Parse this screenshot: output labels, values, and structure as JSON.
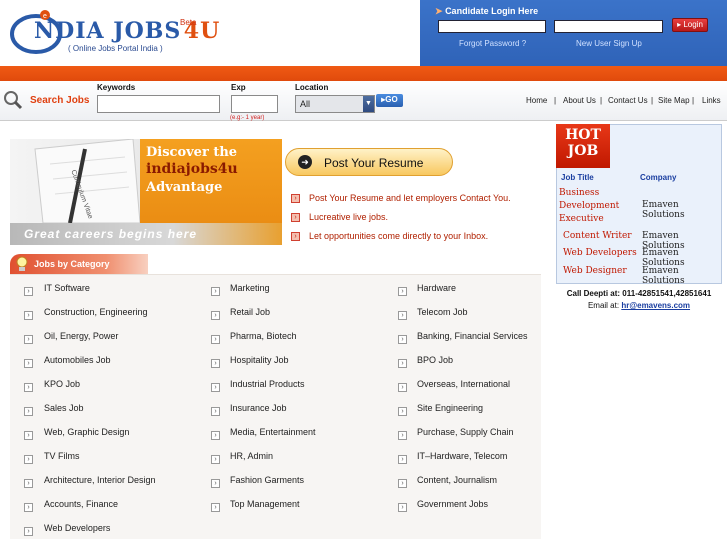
{
  "header": {
    "logo_main": "NDIA JOBS",
    "logo_4u": "4U",
    "logo_beta": "Beta",
    "logo_sub": "( Online Jobs Portal India )"
  },
  "login": {
    "title": "Candidate Login Here",
    "button": "Login",
    "forgot": "Forgot Password ?",
    "signup": "New User Sign Up"
  },
  "search": {
    "label": "Search Jobs",
    "keywords_label": "Keywords",
    "exp_label": "Exp",
    "exp_hint": "(e.g:- 1 year)",
    "location_label": "Location",
    "location_value": "All",
    "go": "GO"
  },
  "nav": [
    "Home",
    "About Us",
    "Contact Us",
    "Site Map",
    "Links"
  ],
  "banner": {
    "promo_line1": "Discover the",
    "promo_brand": "indiajobs4u",
    "promo_line3": "Advantage",
    "strip": "Great careers begins here",
    "cv_label": "Curriculum Vitae",
    "post_resume": "Post Your Resume",
    "benefits": [
      "Post Your Resume and let employers Contact You.",
      "Lucreative live jobs.",
      "Let opportunities come directly to your Inbox."
    ]
  },
  "categories": {
    "header": "Jobs by Category",
    "col1": [
      "IT Software",
      "Construction, Engineering",
      "Oil, Energy, Power",
      "Automobiles Job",
      "KPO Job",
      "Sales Job",
      "Web, Graphic Design",
      "TV Films",
      "Architecture, Interior Design",
      "Accounts, Finance",
      "Web Developers"
    ],
    "col2": [
      "Marketing",
      "Retail Job",
      "Pharma, Biotech",
      "Hospitality Job",
      "Industrial Products",
      "Insurance Job",
      "Media, Entertainment",
      "HR, Admin",
      "Fashion Garments",
      "Top Management"
    ],
    "col3": [
      "Hardware",
      "Telecom Job",
      "Banking, Financial Services",
      "BPO Job",
      "Overseas, International",
      "Site Engineering",
      "Purchase, Supply Chain",
      "IT–Hardware, Telecom",
      "Content, Journalism",
      "Government Jobs"
    ]
  },
  "hot_jobs": {
    "badge_line1": "HOT",
    "badge_line2": "JOB",
    "col_title": "Job Title",
    "col_company": "Company",
    "rows": [
      {
        "title": "Business Development Executive",
        "company": "Emaven Solutions"
      },
      {
        "title": "Content Writer",
        "company": "Emaven Solutions"
      },
      {
        "title": "Web Developers",
        "company": "Emaven Solutions"
      },
      {
        "title": "Web Designer",
        "company": "Emaven Solutions"
      }
    ]
  },
  "contact": {
    "call": "Call Deepti at: 011-42851541,42851641",
    "email_label": "Email at:",
    "email": "hr@emavens.com"
  },
  "colors": {
    "accent_orange": "#e04a0c",
    "brand_blue": "#2a5aa8",
    "login_blue": "#3068bf"
  }
}
